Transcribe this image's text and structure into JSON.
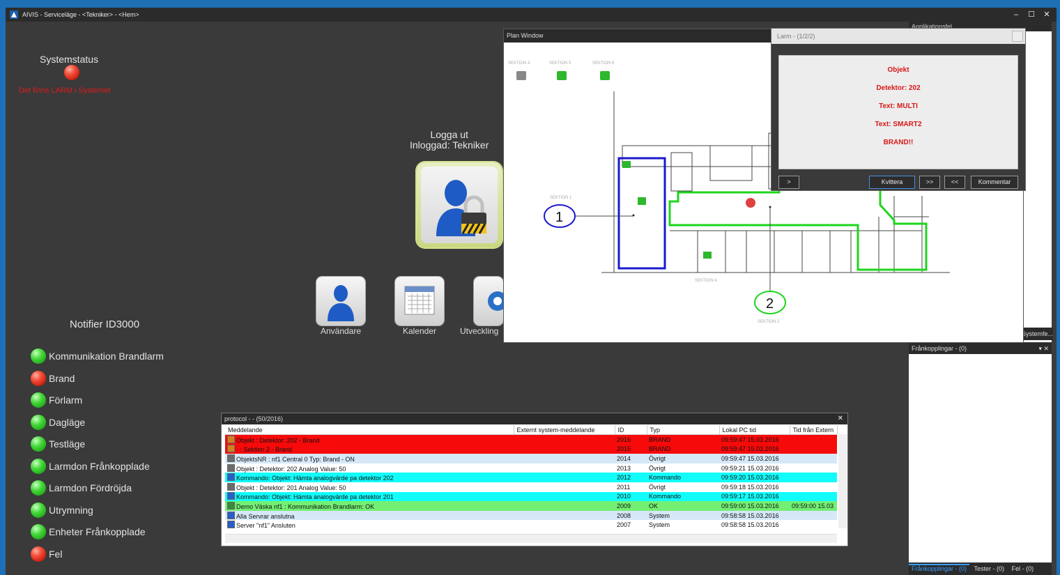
{
  "window": {
    "title": "AIVIS - Serviceläge - <Tekniker> - <Hem>",
    "min": "–",
    "max": "☐",
    "close": "✕"
  },
  "system_status": {
    "title": "Systemstatus",
    "message": "Det finns LARM i Systemet"
  },
  "logout": {
    "line1": "Logga ut",
    "line2": "Inloggad: Tekniker"
  },
  "app_buttons": [
    {
      "label": "Användare"
    },
    {
      "label": "Kalender"
    },
    {
      "label": "Utveckling"
    }
  ],
  "notifier": {
    "title": "Notifier ID3000"
  },
  "statuses": [
    {
      "label": "Kommunikation Brandlarm",
      "state": "green"
    },
    {
      "label": "Brand",
      "state": "red"
    },
    {
      "label": "Förlarm",
      "state": "green"
    },
    {
      "label": "Dagläge",
      "state": "green"
    },
    {
      "label": "Testläge",
      "state": "green"
    },
    {
      "label": "Larmdon Frånkopplade",
      "state": "green"
    },
    {
      "label": "Larmdon Fördröjda",
      "state": "green"
    },
    {
      "label": "Utrymning",
      "state": "green"
    },
    {
      "label": "Enheter Frånkopplade",
      "state": "green"
    },
    {
      "label": "Fel",
      "state": "red"
    }
  ],
  "plan": {
    "title": "Plan Window",
    "sections": [
      "SEKTION 3",
      "SEKTION 5",
      "SEKTION 6",
      "SEKTION 1",
      "SEKTION 4",
      "SEKTION 2"
    ],
    "callouts": [
      "1",
      "2"
    ]
  },
  "alarm": {
    "title": "Larm - (1/2/2)",
    "lines": [
      "Objekt",
      "Detektor: 202",
      "Text: MULTI",
      "Text: SMART2",
      "BRAND!!"
    ],
    "btn_next": ">",
    "btn_ack": "Kvittera",
    "btn_fwd": ">>",
    "btn_back": "<<",
    "btn_comment": "Kommentar"
  },
  "protocol": {
    "title": "protocol - - (50/2016)",
    "columns": [
      "Meddelande",
      "Externt system-meddelande",
      "ID",
      "Typ",
      "Lokal PC tid",
      "Tid från Extern"
    ],
    "rows": [
      {
        "msg": "Objekt : Detektor: 202 - Brand",
        "ext": "",
        "id": "2016",
        "typ": "BRAND",
        "tid": "09:59:47  15.03.2016",
        "ext_tid": "",
        "style": "red",
        "icon": "flame"
      },
      {
        "msg": "- : Sektion 2 - Brand",
        "ext": "",
        "id": "2015",
        "typ": "BRAND",
        "tid": "09:59:47  15.03.2016",
        "ext_tid": "",
        "style": "red",
        "icon": "flame"
      },
      {
        "msg": "ObjektsNR : nf1 Central 0 Typ: Brand - ON",
        "ext": "",
        "id": "2014",
        "typ": "Övrigt",
        "tid": "09:59:47  15.03.2016",
        "ext_tid": "",
        "style": "lb",
        "icon": "obj"
      },
      {
        "msg": "Objekt : Detektor: 202 Analog Value: 50",
        "ext": "",
        "id": "2013",
        "typ": "Övrigt",
        "tid": "09:59:21  15.03.2016",
        "ext_tid": "",
        "style": "wh",
        "icon": "obj"
      },
      {
        "msg": "Kommando: Objekt: Hämta analogvärde pa detektor 202",
        "ext": "",
        "id": "2012",
        "typ": "Kommando",
        "tid": "09:59:20  15.03.2016",
        "ext_tid": "",
        "style": "cy",
        "icon": "cmd"
      },
      {
        "msg": "Objekt : Detektor: 201 Analog Value: 50",
        "ext": "",
        "id": "2011",
        "typ": "Övrigt",
        "tid": "09:59:18  15.03.2016",
        "ext_tid": "",
        "style": "wh",
        "icon": "obj"
      },
      {
        "msg": "Kommando: Objekt: Hämta analogvärde pa detektor 201",
        "ext": "",
        "id": "2010",
        "typ": "Kommando",
        "tid": "09:59:17  15.03.2016",
        "ext_tid": "",
        "style": "cy",
        "icon": "cmd"
      },
      {
        "msg": "Demo Väska nf1 : Kommunikation Brandlarm: OK",
        "ext": "",
        "id": "2009",
        "typ": "OK",
        "tid": "09:59:00  15.03.2016",
        "ext_tid": "09:59:00  15.03",
        "style": "gr",
        "icon": "ok"
      },
      {
        "msg": "Alla Servrar anslutna",
        "ext": "",
        "id": "2008",
        "typ": "System",
        "tid": "09:58:58  15.03.2016",
        "ext_tid": "",
        "style": "lb",
        "icon": "sys"
      },
      {
        "msg": "Server \"nf1\" Ansluten",
        "ext": "",
        "id": "2007",
        "typ": "System",
        "tid": "09:58:58  15.03.2016",
        "ext_tid": "",
        "style": "wh",
        "icon": "sys"
      }
    ]
  },
  "right_panel": {
    "top_title": "Applikationsfel",
    "mid_tab": "Systemfe...",
    "bottom_title": "Frånkopplingar - (0)",
    "tabs": [
      "Frånkopplingar - (0)",
      "Tester - (0)",
      "Fel - (0)"
    ]
  },
  "colors": {
    "alarm_red": "#e01a1a",
    "ok_green": "#2ecc2e",
    "section_blue": "#1a1acc",
    "section_green": "#1ed51e"
  }
}
